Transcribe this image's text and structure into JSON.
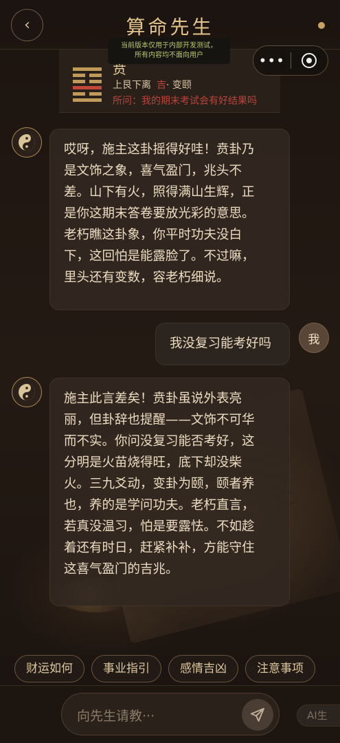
{
  "header": {
    "title": "算命先生",
    "back_icon": "‹"
  },
  "dev_notice": {
    "line1": "当前版本仅用于内部开发测试，",
    "line2": "所有内容均不面向用户"
  },
  "capsule": {
    "more": "•••"
  },
  "hexagram": {
    "name": "贲",
    "trigrams": "上艮下离",
    "luck": "吉",
    "change": "· 变颐",
    "question": "所问：我的期末考试会有好结果吗"
  },
  "messages": [
    {
      "role": "bot",
      "lines": [
        "哎呀，施主这卦摇得好哇！贲卦乃",
        "是文饰之象，喜气盈门，兆头不",
        "差。山下有火，照得满山生辉，正",
        "是你这期末答卷要放光彩的意思。",
        "老朽瞧这卦象，你平时功夫没白",
        "下，这回怕是能露脸了。不过嘛，",
        "里头还有变数，容老朽细说。"
      ]
    },
    {
      "role": "user",
      "avatar": "我",
      "text": "我没复习能考好吗"
    },
    {
      "role": "bot",
      "lines": [
        "施主此言差矣！贲卦虽说外表亮",
        "丽，但卦辞也提醒——文饰不可华",
        "而不实。你问没复习能否考好，这",
        "分明是火苗烧得旺，底下却没柴",
        "火。三九爻动，变卦为颐，颐者养",
        "也，养的是学问功夫。老朽直言，",
        "若真没温习，怕是要露怯。不如趁",
        "着还有时日，赶紧补补，方能守住",
        "这喜气盈门的吉兆。"
      ]
    }
  ],
  "quick_actions": [
    "财运如何",
    "事业指引",
    "感情吉凶",
    "注意事项"
  ],
  "input": {
    "placeholder": "向先生请教···"
  },
  "ai_badge": "AI生",
  "colors": {
    "background": "#1e1612",
    "accent_gold": "#c9a262",
    "text_light": "#ecdcc0",
    "luck_red": "#c2473a"
  }
}
